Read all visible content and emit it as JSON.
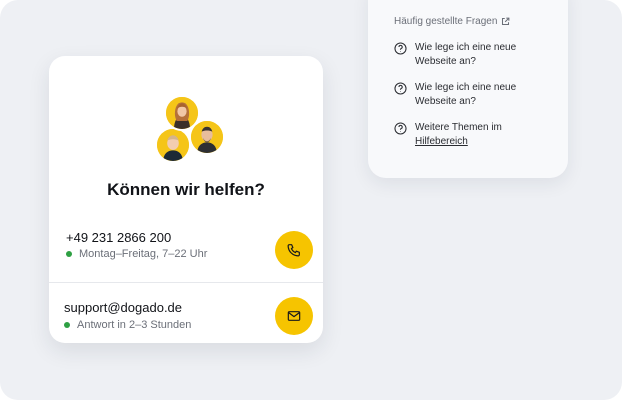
{
  "faq": {
    "header": "Häufig gestellte Fragen",
    "items": [
      {
        "text": "Wie lege ich eine neue Webseite an?"
      },
      {
        "text": "Wie lege ich eine neue Webseite an?"
      }
    ],
    "more_prefix": "Weitere Themen im",
    "more_link": "Hilfebereich"
  },
  "contact": {
    "title": "Können wir helfen?",
    "phone": "+49 231 2866 200",
    "phone_hours": "Montag–Freitag, 7–22 Uhr",
    "email": "support@dogado.de",
    "email_response": "Antwort in 2–3 Stunden"
  },
  "colors": {
    "accent": "#f6c400",
    "status_online": "#2ea043"
  },
  "icons": {
    "faq_link": "external-link-icon",
    "faq_question": "question-circle-icon",
    "call": "phone-icon",
    "mail": "mail-icon"
  }
}
